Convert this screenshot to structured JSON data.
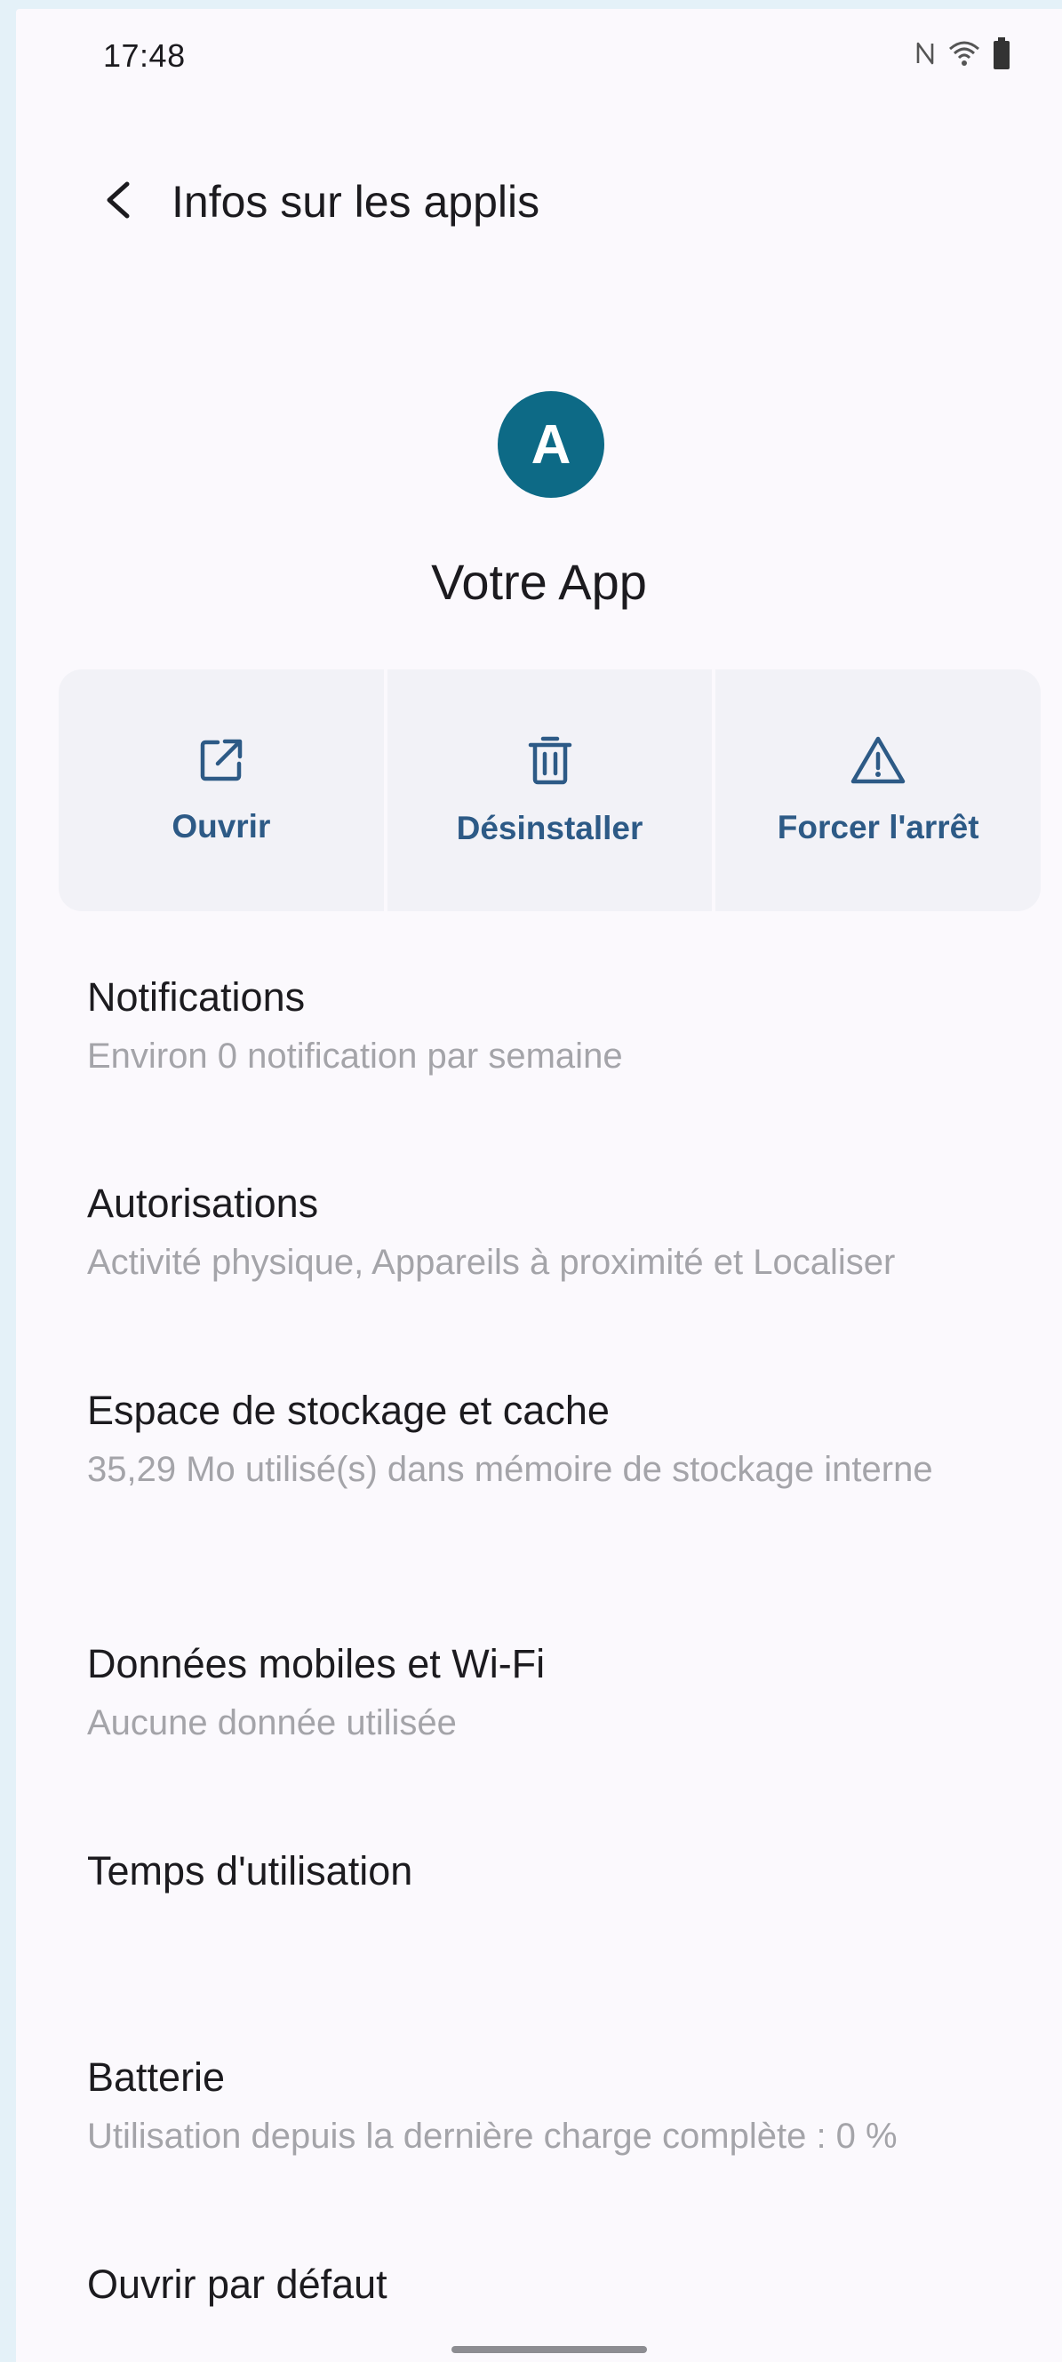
{
  "status_bar": {
    "time": "17:48",
    "icons": [
      "nfc-icon",
      "wifi-icon",
      "battery-icon"
    ]
  },
  "app_bar": {
    "title": "Infos sur les applis",
    "back_icon": "back-arrow-icon"
  },
  "app": {
    "icon_letter": "A",
    "icon_color": "#0d6a86",
    "name": "Votre App"
  },
  "actions": [
    {
      "label": "Ouvrir",
      "icon": "open-external-icon"
    },
    {
      "label": "Désinstaller",
      "icon": "trash-icon"
    },
    {
      "label": "Forcer l'arrêt",
      "icon": "warning-icon"
    }
  ],
  "settings": [
    {
      "title": "Notifications",
      "summary": "Environ 0 notification par semaine"
    },
    {
      "title": "Autorisations",
      "summary": "Activité physique, Appareils à proximité et Localiser"
    },
    {
      "title": "Espace de stockage et cache",
      "summary": "35,29 Mo utilisé(s) dans mémoire de stockage interne"
    },
    {
      "title": "Données mobiles et Wi-Fi",
      "summary": "Aucune donnée utilisée"
    },
    {
      "title": "Temps d'utilisation",
      "summary": ""
    },
    {
      "title": "Batterie",
      "summary": "Utilisation depuis la dernière charge complète : 0 %"
    },
    {
      "title": "Ouvrir par défaut",
      "summary": ""
    }
  ],
  "colors": {
    "accent": "#2d5a86",
    "background": "#fbf9fd",
    "action_background": "#f2f2f7",
    "summary_text": "#a4a4a9"
  }
}
